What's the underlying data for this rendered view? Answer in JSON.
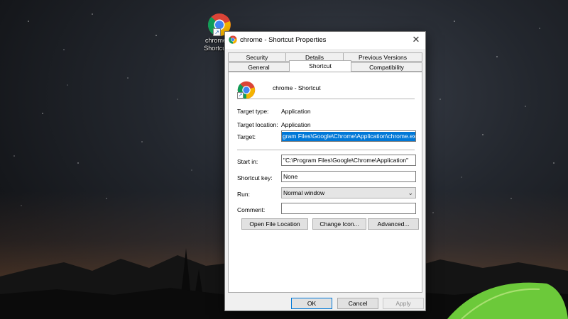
{
  "desktop": {
    "icon_label_line1": "chrome",
    "icon_label_line2": "Shortcut"
  },
  "dialog": {
    "title": "chrome - Shortcut Properties",
    "tabs_row1": [
      "Security",
      "Details",
      "Previous Versions"
    ],
    "tabs_row2": [
      "General",
      "Shortcut",
      "Compatibility"
    ],
    "active_tab": "Shortcut",
    "shortcut_name": "chrome - Shortcut",
    "target_type_label": "Target type:",
    "target_type_value": "Application",
    "target_location_label": "Target location:",
    "target_location_value": "Application",
    "target_label": "Target:",
    "target_value": "gram Files\\Google\\Chrome\\Application\\chrome.exe\"",
    "start_in_label": "Start in:",
    "start_in_value": "\"C:\\Program Files\\Google\\Chrome\\Application\"",
    "shortcut_key_label": "Shortcut key:",
    "shortcut_key_value": "None",
    "run_label": "Run:",
    "run_value": "Normal window",
    "comment_label": "Comment:",
    "comment_value": "",
    "open_file_location": "Open File Location",
    "change_icon": "Change Icon...",
    "advanced": "Advanced...",
    "ok": "OK",
    "cancel": "Cancel",
    "apply": "Apply",
    "close_glyph": "✕"
  },
  "colors": {
    "selection": "#0078d7",
    "dialog_bg": "#f0f0f0",
    "tent_green": "#6cc93a"
  },
  "icons": {
    "app": "chrome-icon",
    "shortcut_overlay": "shortcut-arrow-icon",
    "dropdown": "chevron-down-icon",
    "close": "close-icon"
  }
}
